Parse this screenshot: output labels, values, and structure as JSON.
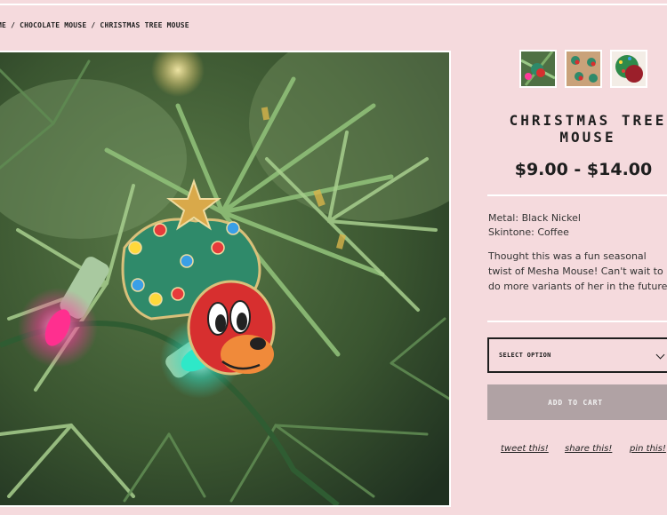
{
  "breadcrumb": {
    "home": "ME",
    "sep1": " / ",
    "category": "CHOCOLATE MOUSE",
    "sep2": " / ",
    "current": "CHRISTMAS TREE MOUSE"
  },
  "product": {
    "title": "CHRISTMAS TREE MOUSE",
    "price": "$9.00 - $14.00",
    "metal": "Metal: Black Nickel",
    "skintone": "Skintone: Coffee",
    "description": "Thought this was a fun seasonal twist of Mesha Mouse! Can't wait to do more variants of her in the future."
  },
  "thumbnails": [
    "thumbnail-1",
    "thumbnail-2",
    "thumbnail-3"
  ],
  "option_select": {
    "label": "SELECT OPTION"
  },
  "cart": {
    "label": "ADD TO CART"
  },
  "share": {
    "tweet": "tweet this!",
    "share": "share this!",
    "pin": "pin this!"
  },
  "colors": {
    "background": "#f5dadd",
    "text": "#1e1e1e",
    "button_disabled": "#b0a2a4"
  },
  "icons": {
    "select": "chevron-down-icon"
  }
}
